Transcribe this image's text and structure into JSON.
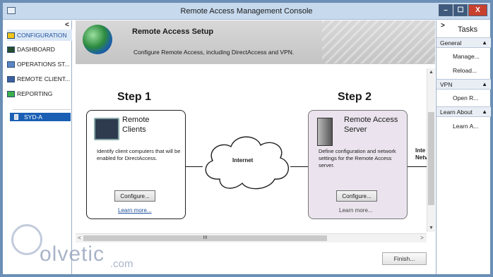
{
  "window": {
    "title": "Remote Access Management Console",
    "min": "–",
    "max": "☐",
    "close": "X"
  },
  "nav": {
    "collapse": "<",
    "items": [
      {
        "label": "CONFIGURATION"
      },
      {
        "label": "DASHBOARD"
      },
      {
        "label": "OPERATIONS ST..."
      },
      {
        "label": "REMOTE CLIENT..."
      },
      {
        "label": "REPORTING"
      }
    ],
    "server": "SYD-A"
  },
  "header": {
    "title": "Remote Access Setup",
    "subtitle": "Configure Remote Access, including DirectAccess and VPN."
  },
  "steps": {
    "step1": {
      "label": "Step 1",
      "card_title_line1": "Remote",
      "card_title_line2": "Clients",
      "desc": "Identify client computers that will be enabled for DirectAccess.",
      "button": "Configure...",
      "link": "Learn more..."
    },
    "step2": {
      "label": "Step 2",
      "card_title_line1": "Remote Access",
      "card_title_line2": "Server",
      "desc": "Define configuration and network settings for the Remote Access server.",
      "button": "Configure...",
      "link": "Learn more..."
    },
    "internet": "Internet",
    "cut_label_1": "Inte",
    "cut_label_2": "Netv"
  },
  "finish": "Finish...",
  "tasks": {
    "title": "Tasks",
    "chevron": ">",
    "sections": [
      {
        "name": "General",
        "items": [
          "Manage...",
          "Reload..."
        ]
      },
      {
        "name": "VPN",
        "items": [
          "Open R..."
        ]
      },
      {
        "name": "Learn About",
        "items": [
          "Learn A..."
        ]
      }
    ]
  },
  "watermark": {
    "text": "olvetic",
    "suffix": ".com"
  },
  "colors": {
    "accent": "#1a5fb4",
    "titlebar": "#c7d9ed",
    "close": "#c8412f"
  }
}
